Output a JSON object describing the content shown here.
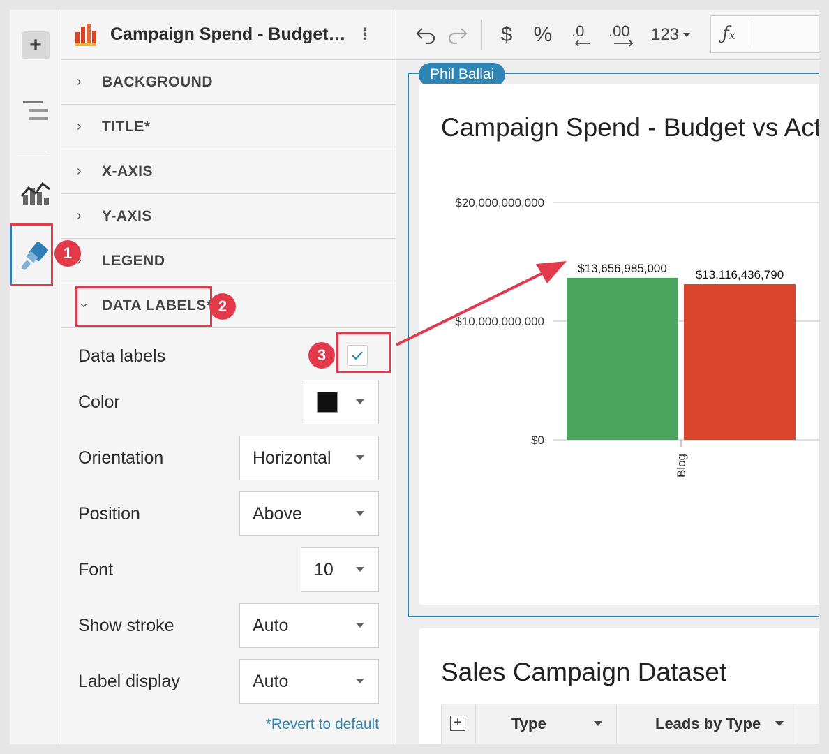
{
  "panel": {
    "title": "Campaign Spend - Budget vs Actual",
    "sections": [
      {
        "label": "BACKGROUND",
        "expanded": false
      },
      {
        "label": "TITLE*",
        "expanded": false
      },
      {
        "label": "X-AXIS",
        "expanded": false
      },
      {
        "label": "Y-AXIS",
        "expanded": false
      },
      {
        "label": "LEGEND",
        "expanded": false
      },
      {
        "label": "DATA LABELS*",
        "expanded": true
      }
    ],
    "data_labels": {
      "toggle_label": "Data labels",
      "toggle_checked": true,
      "color_label": "Color",
      "color_value": "#111111",
      "orientation_label": "Orientation",
      "orientation_value": "Horizontal",
      "position_label": "Position",
      "position_value": "Above",
      "font_label": "Font",
      "font_value": "10",
      "stroke_label": "Show stroke",
      "stroke_value": "Auto",
      "label_display_label": "Label display",
      "label_display_value": "Auto"
    },
    "revert_label": "*Revert to default"
  },
  "toolbar": {
    "number_format": "123"
  },
  "chart_card": {
    "user_tag": "Phil Ballai",
    "title": "Campaign Spend - Budget vs Actual"
  },
  "chart_data": {
    "type": "bar",
    "categories": [
      "Blog"
    ],
    "series": [
      {
        "values": [
          13656985000
        ],
        "color": "#4aa65c"
      },
      {
        "values": [
          13116436790
        ],
        "color": "#d9442b"
      }
    ],
    "data_labels": [
      "$13,656,985,000",
      "$13,116,436,790"
    ],
    "y_ticks": [
      "$0",
      "$10,000,000,000",
      "$20,000,000,000"
    ],
    "ylim": [
      0,
      20000000000
    ],
    "grid": true
  },
  "table_card": {
    "title": "Sales Campaign Dataset",
    "columns": [
      "Type",
      "Leads by Type"
    ]
  },
  "annotations": [
    "1",
    "2",
    "3"
  ],
  "colors": {
    "accent": "#2f86b5",
    "annotation": "#e33a4b"
  }
}
